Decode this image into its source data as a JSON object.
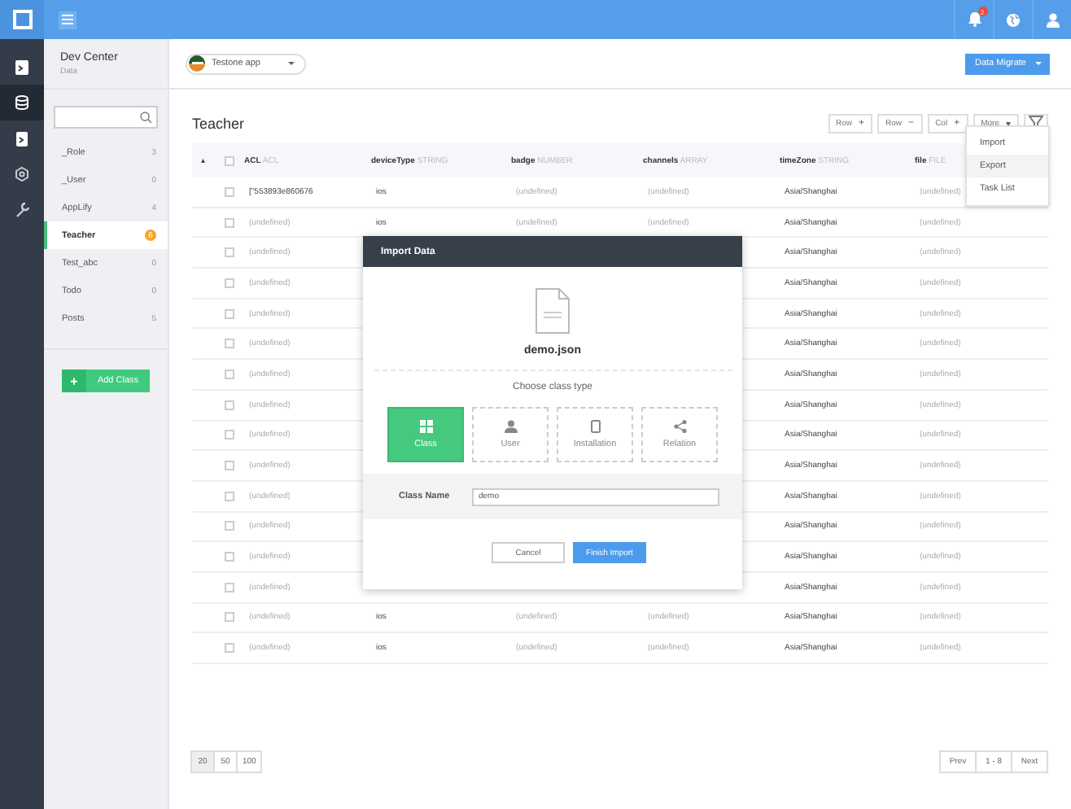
{
  "topbar": {
    "notifications": "2"
  },
  "rail": [
    {
      "selected": false
    },
    {
      "selected": true
    },
    {
      "selected": false
    },
    {
      "selected": false
    },
    {
      "selected": false
    }
  ],
  "sidebar": {
    "title": "Dev Center",
    "subtitle": "Data",
    "classes": [
      {
        "name": "_Role",
        "count": "3",
        "selected": false
      },
      {
        "name": "_User",
        "count": "0",
        "selected": false
      },
      {
        "name": "AppLify",
        "count": "4",
        "selected": false
      },
      {
        "name": "Teacher",
        "count": "6",
        "selected": true
      },
      {
        "name": "Test_abc",
        "count": "0",
        "selected": false
      },
      {
        "name": "Todo",
        "count": "0",
        "selected": false
      },
      {
        "name": "Posts",
        "count": "5",
        "selected": false
      }
    ],
    "add_button": {
      "icon": "+",
      "label": "Add Class"
    }
  },
  "app_selector": {
    "label": "Testone app"
  },
  "migrate": {
    "label": "Data Migrate",
    "menu": [
      {
        "label": "Import",
        "selected": false
      },
      {
        "label": "Export",
        "selected": true
      },
      {
        "label": "Task List",
        "selected": false
      }
    ]
  },
  "table": {
    "title": "Teacher",
    "toolbar": [
      {
        "label": "Row",
        "sign": "+"
      },
      {
        "label": "Row",
        "sign": "−"
      },
      {
        "label": "Col",
        "sign": "+"
      },
      {
        "label": "More",
        "sign": "▾"
      }
    ],
    "sort_mark": "▴",
    "all_checked": false,
    "columns": [
      {
        "name": "ACL",
        "type": "ACL"
      },
      {
        "name": "deviceType",
        "type": "STRING"
      },
      {
        "name": "badge",
        "type": "NUMBER"
      },
      {
        "name": "channels",
        "type": "ARRAY"
      },
      {
        "name": "timeZone",
        "type": "STRING"
      },
      {
        "name": "file",
        "type": "FILE"
      }
    ],
    "rows": [
      {
        "checked": false,
        "acl": {
          "text": "[\"553893e860676",
          "muted": false
        },
        "device_type": {
          "text": "ios",
          "muted": false
        },
        "badge": {
          "text": "(undefined)",
          "muted": true
        },
        "channels": {
          "text": "(undefined)",
          "muted": true
        },
        "time_zone": {
          "text": "Asia/Shanghai",
          "muted": false
        },
        "file": {
          "text": "(undefined)",
          "muted": true
        }
      },
      {
        "checked": false,
        "acl": {
          "text": "(undefined)",
          "muted": true
        },
        "device_type": {
          "text": "ios",
          "muted": false
        },
        "badge": {
          "text": "(undefined)",
          "muted": true
        },
        "channels": {
          "text": "(undefined)",
          "muted": true
        },
        "time_zone": {
          "text": "Asia/Shanghai",
          "muted": false
        },
        "file": {
          "text": "(undefined)",
          "muted": true
        }
      },
      {
        "checked": false,
        "acl": {
          "text": "(undefined)",
          "muted": true
        },
        "time_zone": {
          "text": "Asia/Shanghai",
          "muted": false
        },
        "file": {
          "text": "(undefined)",
          "muted": true
        }
      },
      {
        "checked": false,
        "acl": {
          "text": "(undefined)",
          "muted": true
        },
        "time_zone": {
          "text": "Asia/Shanghai",
          "muted": false
        },
        "file": {
          "text": "(undefined)",
          "muted": true
        }
      },
      {
        "checked": false,
        "acl": {
          "text": "(undefined)",
          "muted": true
        },
        "time_zone": {
          "text": "Asia/Shanghai",
          "muted": false
        },
        "file": {
          "text": "(undefined)",
          "muted": true
        }
      },
      {
        "checked": false,
        "acl": {
          "text": "(undefined)",
          "muted": true
        },
        "time_zone": {
          "text": "Asia/Shanghai",
          "muted": false
        },
        "file": {
          "text": "(undefined)",
          "muted": true
        }
      },
      {
        "checked": false,
        "acl": {
          "text": "(undefined)",
          "muted": true
        },
        "time_zone": {
          "text": "Asia/Shanghai",
          "muted": false
        },
        "file": {
          "text": "(undefined)",
          "muted": true
        }
      },
      {
        "checked": false,
        "acl": {
          "text": "(undefined)",
          "muted": true
        },
        "time_zone": {
          "text": "Asia/Shanghai",
          "muted": false
        },
        "file": {
          "text": "(undefined)",
          "muted": true
        }
      },
      {
        "checked": false,
        "acl": {
          "text": "(undefined)",
          "muted": true
        },
        "time_zone": {
          "text": "Asia/Shanghai",
          "muted": false
        },
        "file": {
          "text": "(undefined)",
          "muted": true
        }
      },
      {
        "checked": false,
        "acl": {
          "text": "(undefined)",
          "muted": true
        },
        "time_zone": {
          "text": "Asia/Shanghai",
          "muted": false
        },
        "file": {
          "text": "(undefined)",
          "muted": true
        }
      },
      {
        "checked": false,
        "acl": {
          "text": "(undefined)",
          "muted": true
        },
        "time_zone": {
          "text": "Asia/Shanghai",
          "muted": false
        },
        "file": {
          "text": "(undefined)",
          "muted": true
        }
      },
      {
        "checked": false,
        "acl": {
          "text": "(undefined)",
          "muted": true
        },
        "time_zone": {
          "text": "Asia/Shanghai",
          "muted": false
        },
        "file": {
          "text": "(undefined)",
          "muted": true
        }
      },
      {
        "checked": false,
        "acl": {
          "text": "(undefined)",
          "muted": true
        },
        "time_zone": {
          "text": "Asia/Shanghai",
          "muted": false
        },
        "file": {
          "text": "(undefined)",
          "muted": true
        }
      },
      {
        "checked": false,
        "acl": {
          "text": "(undefined)",
          "muted": true
        },
        "time_zone": {
          "text": "Asia/Shanghai",
          "muted": false
        },
        "file": {
          "text": "(undefined)",
          "muted": true
        }
      },
      {
        "checked": false,
        "acl": {
          "text": "(undefined)",
          "muted": true
        },
        "device_type": {
          "text": "ios",
          "muted": false
        },
        "badge": {
          "text": "(undefined)",
          "muted": true
        },
        "channels": {
          "text": "(undefined)",
          "muted": true
        },
        "time_zone": {
          "text": "Asia/Shanghai",
          "muted": false
        },
        "file": {
          "text": "(undefined)",
          "muted": true
        }
      },
      {
        "checked": false,
        "acl": {
          "text": "(undefined)",
          "muted": true
        },
        "device_type": {
          "text": "ios",
          "muted": false
        },
        "badge": {
          "text": "(undefined)",
          "muted": true
        },
        "channels": {
          "text": "(undefined)",
          "muted": true
        },
        "time_zone": {
          "text": "Asia/Shanghai",
          "muted": false
        },
        "file": {
          "text": "(undefined)",
          "muted": true
        }
      }
    ],
    "page_sizes": [
      {
        "label": "20",
        "selected": true
      },
      {
        "label": "50",
        "selected": false
      },
      {
        "label": "100",
        "selected": false
      }
    ],
    "pager": {
      "prev": "Prev",
      "range": "1 - 8",
      "next": "Next"
    }
  },
  "dialog": {
    "title": "Import Data",
    "file_name": "demo.json",
    "prompt": "Choose class type",
    "types": [
      {
        "label": "Class",
        "selected": true
      },
      {
        "label": "User",
        "selected": false
      },
      {
        "label": "Installation",
        "selected": false
      },
      {
        "label": "Relation",
        "selected": false
      }
    ],
    "class_name": {
      "label": "Class Name",
      "value": "demo"
    },
    "buttons": [
      {
        "kind": "plain",
        "label": "Cancel"
      },
      {
        "kind": "primary",
        "label": "Finish Import"
      }
    ]
  }
}
